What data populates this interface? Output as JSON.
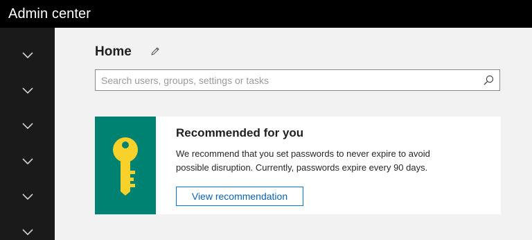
{
  "header": {
    "title": "Admin center"
  },
  "sidebar": {
    "items": [
      {
        "icon": "chevron-down-icon"
      },
      {
        "icon": "chevron-down-icon"
      },
      {
        "icon": "chevron-down-icon"
      },
      {
        "icon": "chevron-down-icon"
      },
      {
        "icon": "chevron-down-icon"
      },
      {
        "icon": "chevron-down-icon"
      }
    ]
  },
  "main": {
    "page_title": "Home",
    "edit_icon": "pencil-icon",
    "search": {
      "placeholder": "Search users, groups, settings or tasks",
      "value": "",
      "icon": "search-icon"
    },
    "recommendation_card": {
      "icon": "key-icon",
      "title": "Recommended for you",
      "line1": "We recommend that you set passwords to never expire to avoid",
      "line2": "possible disruption. Currently, passwords expire every 90 days.",
      "button_label": "View recommendation"
    }
  },
  "colors": {
    "topbar": "#000000",
    "sidebar": "#1a1a1a",
    "background": "#f2f2f2",
    "card_accent": "#008272",
    "key": "#f8d22a",
    "button_border": "#0078d4"
  }
}
